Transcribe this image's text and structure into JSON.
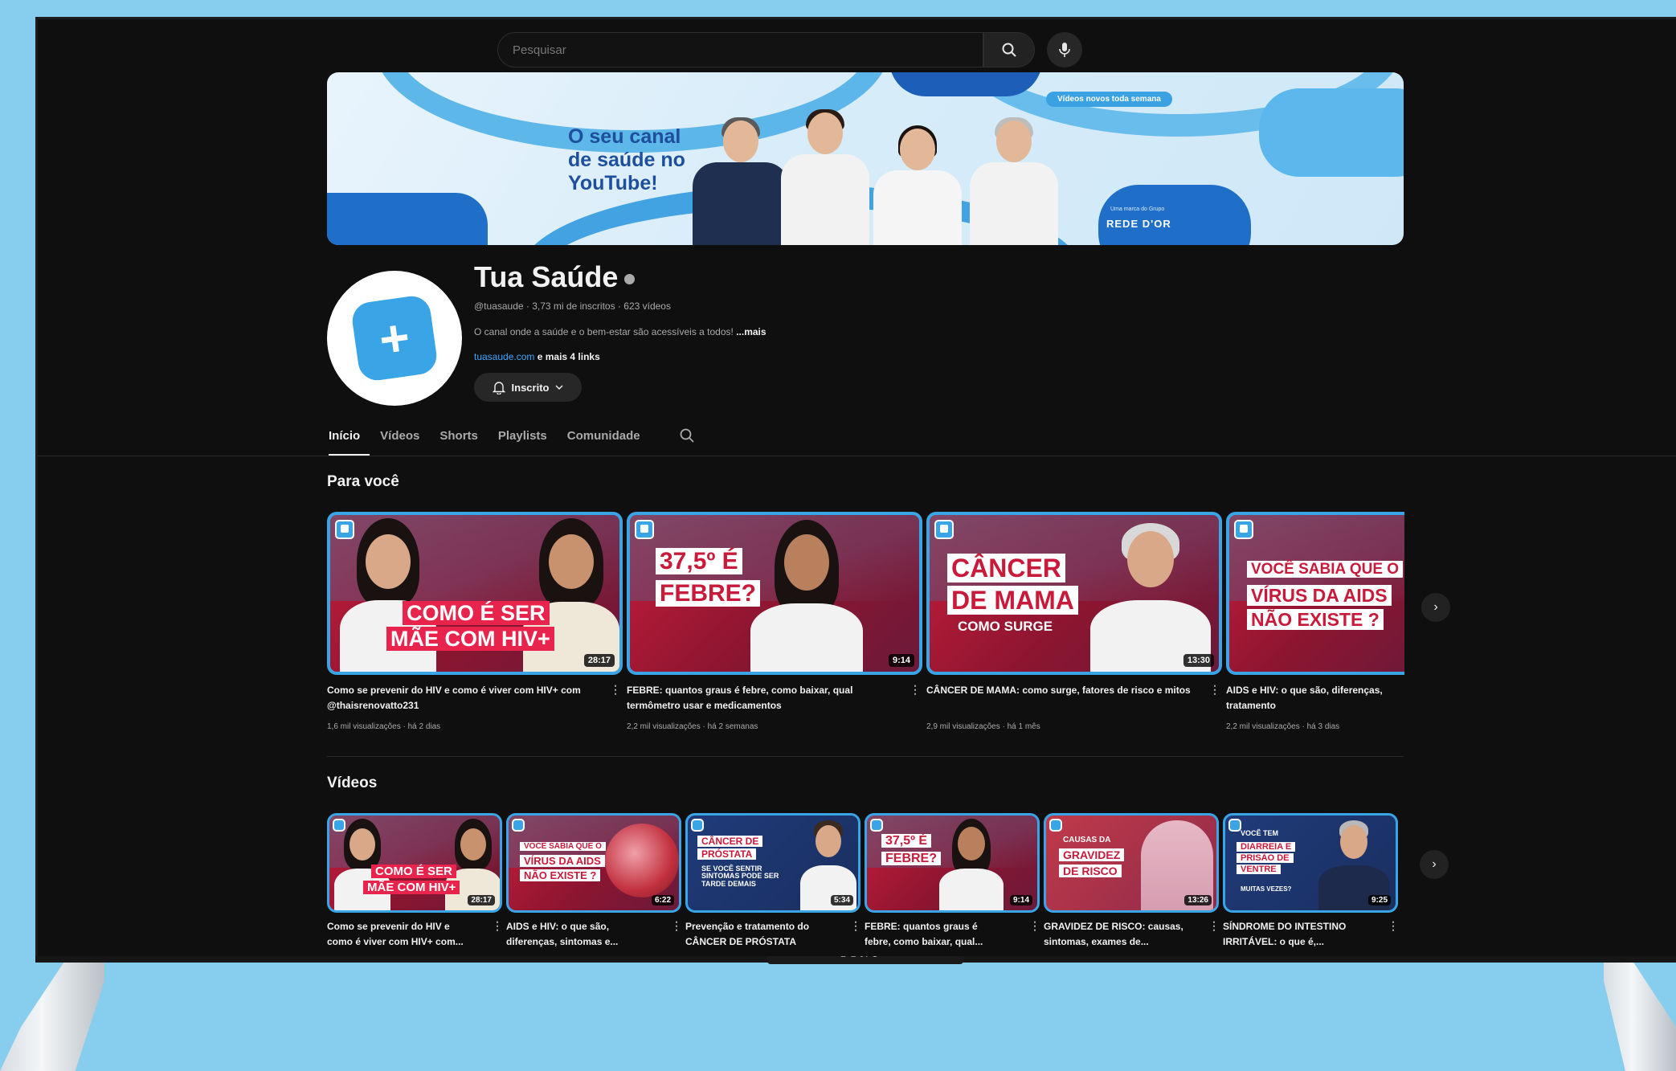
{
  "search": {
    "placeholder": "Pesquisar"
  },
  "banner": {
    "headline_1": "O seu canal",
    "headline_2": "de saúde no",
    "headline_3": "YouTube!",
    "pill": "Vídeos novos toda semana",
    "logo_small": "Uma marca do Grupo",
    "logo": "REDE D'OR"
  },
  "channel": {
    "name": "Tua Saúde",
    "meta": "@tuasaude · 3,73 mi de inscritos · 623 vídeos",
    "description": "O canal onde a saúde e o bem-estar são acessíveis a todos! ",
    "description_more": "...mais",
    "link": "tuasaude.com",
    "link_more": " e mais 4 links",
    "subscribe_label": "Inscrito"
  },
  "tabs": [
    "Início",
    "Vídeos",
    "Shorts",
    "Playlists",
    "Comunidade"
  ],
  "sections": {
    "for_you": "Para você",
    "videos": "Vídeos"
  },
  "for_you": [
    {
      "title": "Como se prevenir do HIV e como é viver com HIV+ com @thaisrenovatto231",
      "meta": "1,6 mil visualizações · há 2 dias",
      "duration": "28:17",
      "caption_1": "COMO É SER",
      "caption_2": "MÃE COM HIV+"
    },
    {
      "title": "FEBRE: quantos graus é febre, como baixar, qual termômetro usar e medicamentos",
      "meta": "2,2 mil visualizações · há 2 semanas",
      "duration": "9:14",
      "caption_1": "37,5º É",
      "caption_2": "FEBRE?"
    },
    {
      "title": "CÂNCER DE MAMA: como surge, fatores de risco e mitos",
      "meta": "2,9 mil visualizações · há 1 mês",
      "duration": "13:30",
      "caption_1": "CÂNCER",
      "caption_2": "DE MAMA",
      "caption_3": "COMO SURGE"
    },
    {
      "title": "AIDS e HIV: o que são, diferenças, tratamento",
      "meta": "2,2 mil visualizações · há 3 dias",
      "duration": "",
      "caption_1": "VOCÊ SABIA QUE O",
      "caption_2": "VÍRUS DA AIDS",
      "caption_3": "NÃO EXISTE ?"
    }
  ],
  "videos": [
    {
      "title_1": "Como se prevenir do HIV e",
      "title_2": "como é viver com HIV+ com...",
      "duration": "28:17",
      "caption_1": "COMO É SER",
      "caption_2": "MÃE COM HIV+"
    },
    {
      "title_1": "AIDS e HIV: o que são,",
      "title_2": "diferenças, sintomas e...",
      "duration": "6:22",
      "caption_1": "VOCÊ SABIA QUE O",
      "caption_2": "VÍRUS DA AIDS",
      "caption_3": "NÃO EXISTE ?"
    },
    {
      "title_1": "Prevenção e tratamento do",
      "title_2": "CÂNCER DE PRÓSTATA",
      "duration": "5:34",
      "caption_1": "CÂNCER DE",
      "caption_2": "PRÓSTATA",
      "caption_3": "SE VOCÊ SENTIR SINTOMAS PODE SER TARDE DEMAIS"
    },
    {
      "title_1": "FEBRE: quantos graus é",
      "title_2": "febre, como baixar, qual...",
      "duration": "9:14",
      "caption_1": "37,5º É",
      "caption_2": "FEBRE?"
    },
    {
      "title_1": "GRAVIDEZ DE RISCO: causas,",
      "title_2": "sintomas, exames de...",
      "duration": "13:26",
      "caption_1": "CAUSAS DA",
      "caption_2": "GRAVIDEZ",
      "caption_3": "DE RISCO"
    },
    {
      "title_1": "SÍNDROME DO INTESTINO",
      "title_2": "IRRITÁVEL: o que é,...",
      "duration": "9:25",
      "caption_1": "VOCÊ TEM",
      "caption_2": "DIARREIA E PRISÃO DE VENTRE",
      "caption_3": "MUITAS VEZES?"
    }
  ],
  "tv": {
    "brand": "SONY"
  },
  "colors": {
    "accent": "#3aa5e6",
    "thumb_red": "#c51d3b",
    "link": "#3ea6ff"
  }
}
